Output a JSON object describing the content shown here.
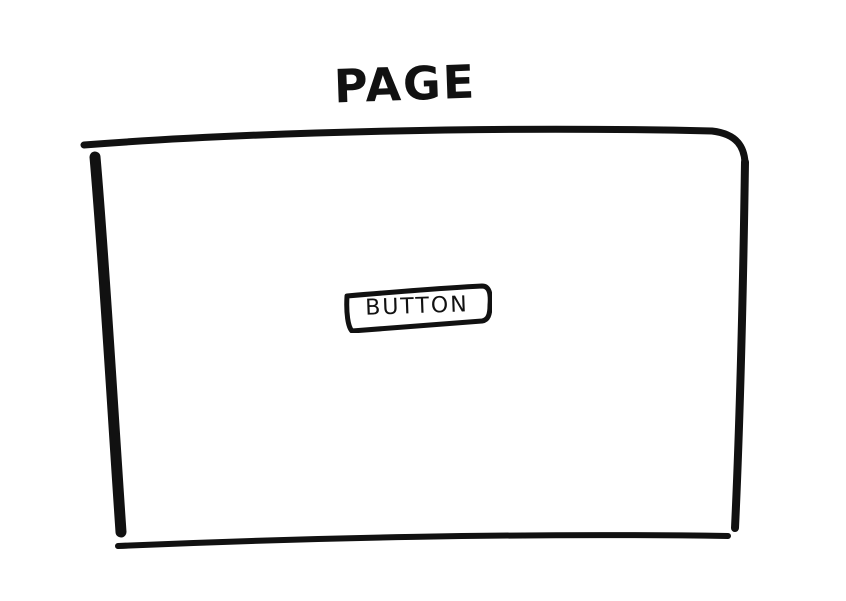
{
  "title": "PAGE",
  "button": {
    "label": "BUTTON"
  },
  "colors": {
    "ink": "#111111",
    "paper": "#ffffff"
  }
}
